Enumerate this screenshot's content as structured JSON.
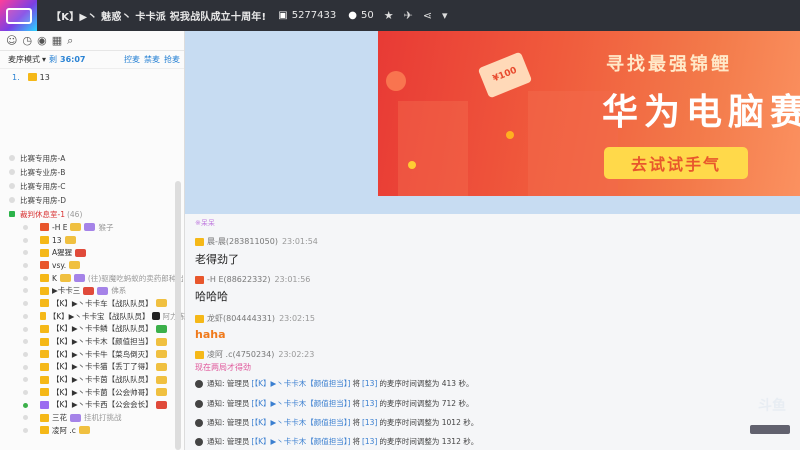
{
  "topbar": {
    "title": "【K】▶丶 魅惑丶 卡卡派  祝我战队成立十周年!",
    "room_id": "5277433",
    "online": "50"
  },
  "sidebar": {
    "mode_label": "麦序模式",
    "time_prefix": "剩",
    "time": "36:07",
    "links": [
      "控麦",
      "禁麦",
      "抢麦"
    ],
    "queue_num": "1.",
    "queue_user": "13",
    "rooms": [
      "比赛专用房-A",
      "比赛专业房-B",
      "比赛专用房-C",
      "比赛专用房-D"
    ],
    "active_room": "裁判休息室-1",
    "active_room_count": "(46)",
    "members": [
      {
        "name": "-H E",
        "extra": "猴子"
      },
      {
        "name": "13",
        "extra": ""
      },
      {
        "name": "A猩猩",
        "extra": ""
      },
      {
        "name": "vsy.",
        "extra": ""
      },
      {
        "name": "K",
        "extra": "(往)驱魔吃蚂蚁的卖药郎种出"
      },
      {
        "name": "▶卡卡三",
        "extra": "佛系"
      },
      {
        "name": "【K】▶丶卡卡车【战队队员】",
        "extra": ""
      },
      {
        "name": "【K】▶丶卡卡宝【战队队员】",
        "extra": "阿力练"
      },
      {
        "name": "【K】▶丶卡卡鳞【战队队员】",
        "extra": ""
      },
      {
        "name": "【K】▶丶卡卡木【颜值担当】",
        "extra": ""
      },
      {
        "name": "【K】▶丶卡卡牛【菜鸟倒灭】",
        "extra": ""
      },
      {
        "name": "【K】▶丶卡卡猫【丢丁了得】",
        "extra": ""
      },
      {
        "name": "【K】▶丶卡卡茵【战队队员】",
        "extra": ""
      },
      {
        "name": "【K】▶丶卡卡菌【公会帅哥】",
        "extra": ""
      },
      {
        "name": "【K】▶丶卡卡西【公会会长】",
        "extra": ""
      },
      {
        "name": "三花",
        "extra": "挂机打挑战"
      },
      {
        "name": "凌阿 .c",
        "extra": ""
      }
    ]
  },
  "banner": {
    "headline": "寻找最强锦鲤",
    "product": "华为电脑赛",
    "cta": "去试试手气",
    "coupon": "¥100"
  },
  "chat": {
    "topline": "※呆呆",
    "messages": [
      {
        "user": "晨-晨(283811050)",
        "time": "23:01:54",
        "text": "老得劲了",
        "style": ""
      },
      {
        "user": "-H E(88622332)",
        "time": "23:01:56",
        "text": "哈哈哈",
        "style": ""
      },
      {
        "user": "龙虾(804444331)",
        "time": "23:02:15",
        "text": "haha",
        "style": "orange"
      },
      {
        "user": "凌阿 .c(4750234)",
        "time": "23:02:23",
        "text": "现在两局才得劲",
        "style": "pink"
      }
    ],
    "notices": [
      {
        "prefix": "通知: 管理员 ",
        "who": "[【K】▶丶卡卡木【颜值担当】]",
        "mid": " 将 ",
        "target": "[13]",
        "suffix": " 的麦序时间调整为 413 秒。"
      },
      {
        "prefix": "通知: 管理员 ",
        "who": "[【K】▶丶卡卡木【颜值担当】]",
        "mid": " 将 ",
        "target": "[13]",
        "suffix": " 的麦序时间调整为 712 秒。"
      },
      {
        "prefix": "通知: 管理员 ",
        "who": "[【K】▶丶卡卡木【颜值担当】]",
        "mid": " 将 ",
        "target": "[13]",
        "suffix": " 的麦序时间调整为 1012 秒。"
      },
      {
        "prefix": "通知: 管理员 ",
        "who": "[【K】▶丶卡卡木【颜值担当】]",
        "mid": " 将 ",
        "target": "[13]",
        "suffix": " 的麦序时间调整为 1312 秒。"
      }
    ]
  },
  "watermark": "斗鱼"
}
